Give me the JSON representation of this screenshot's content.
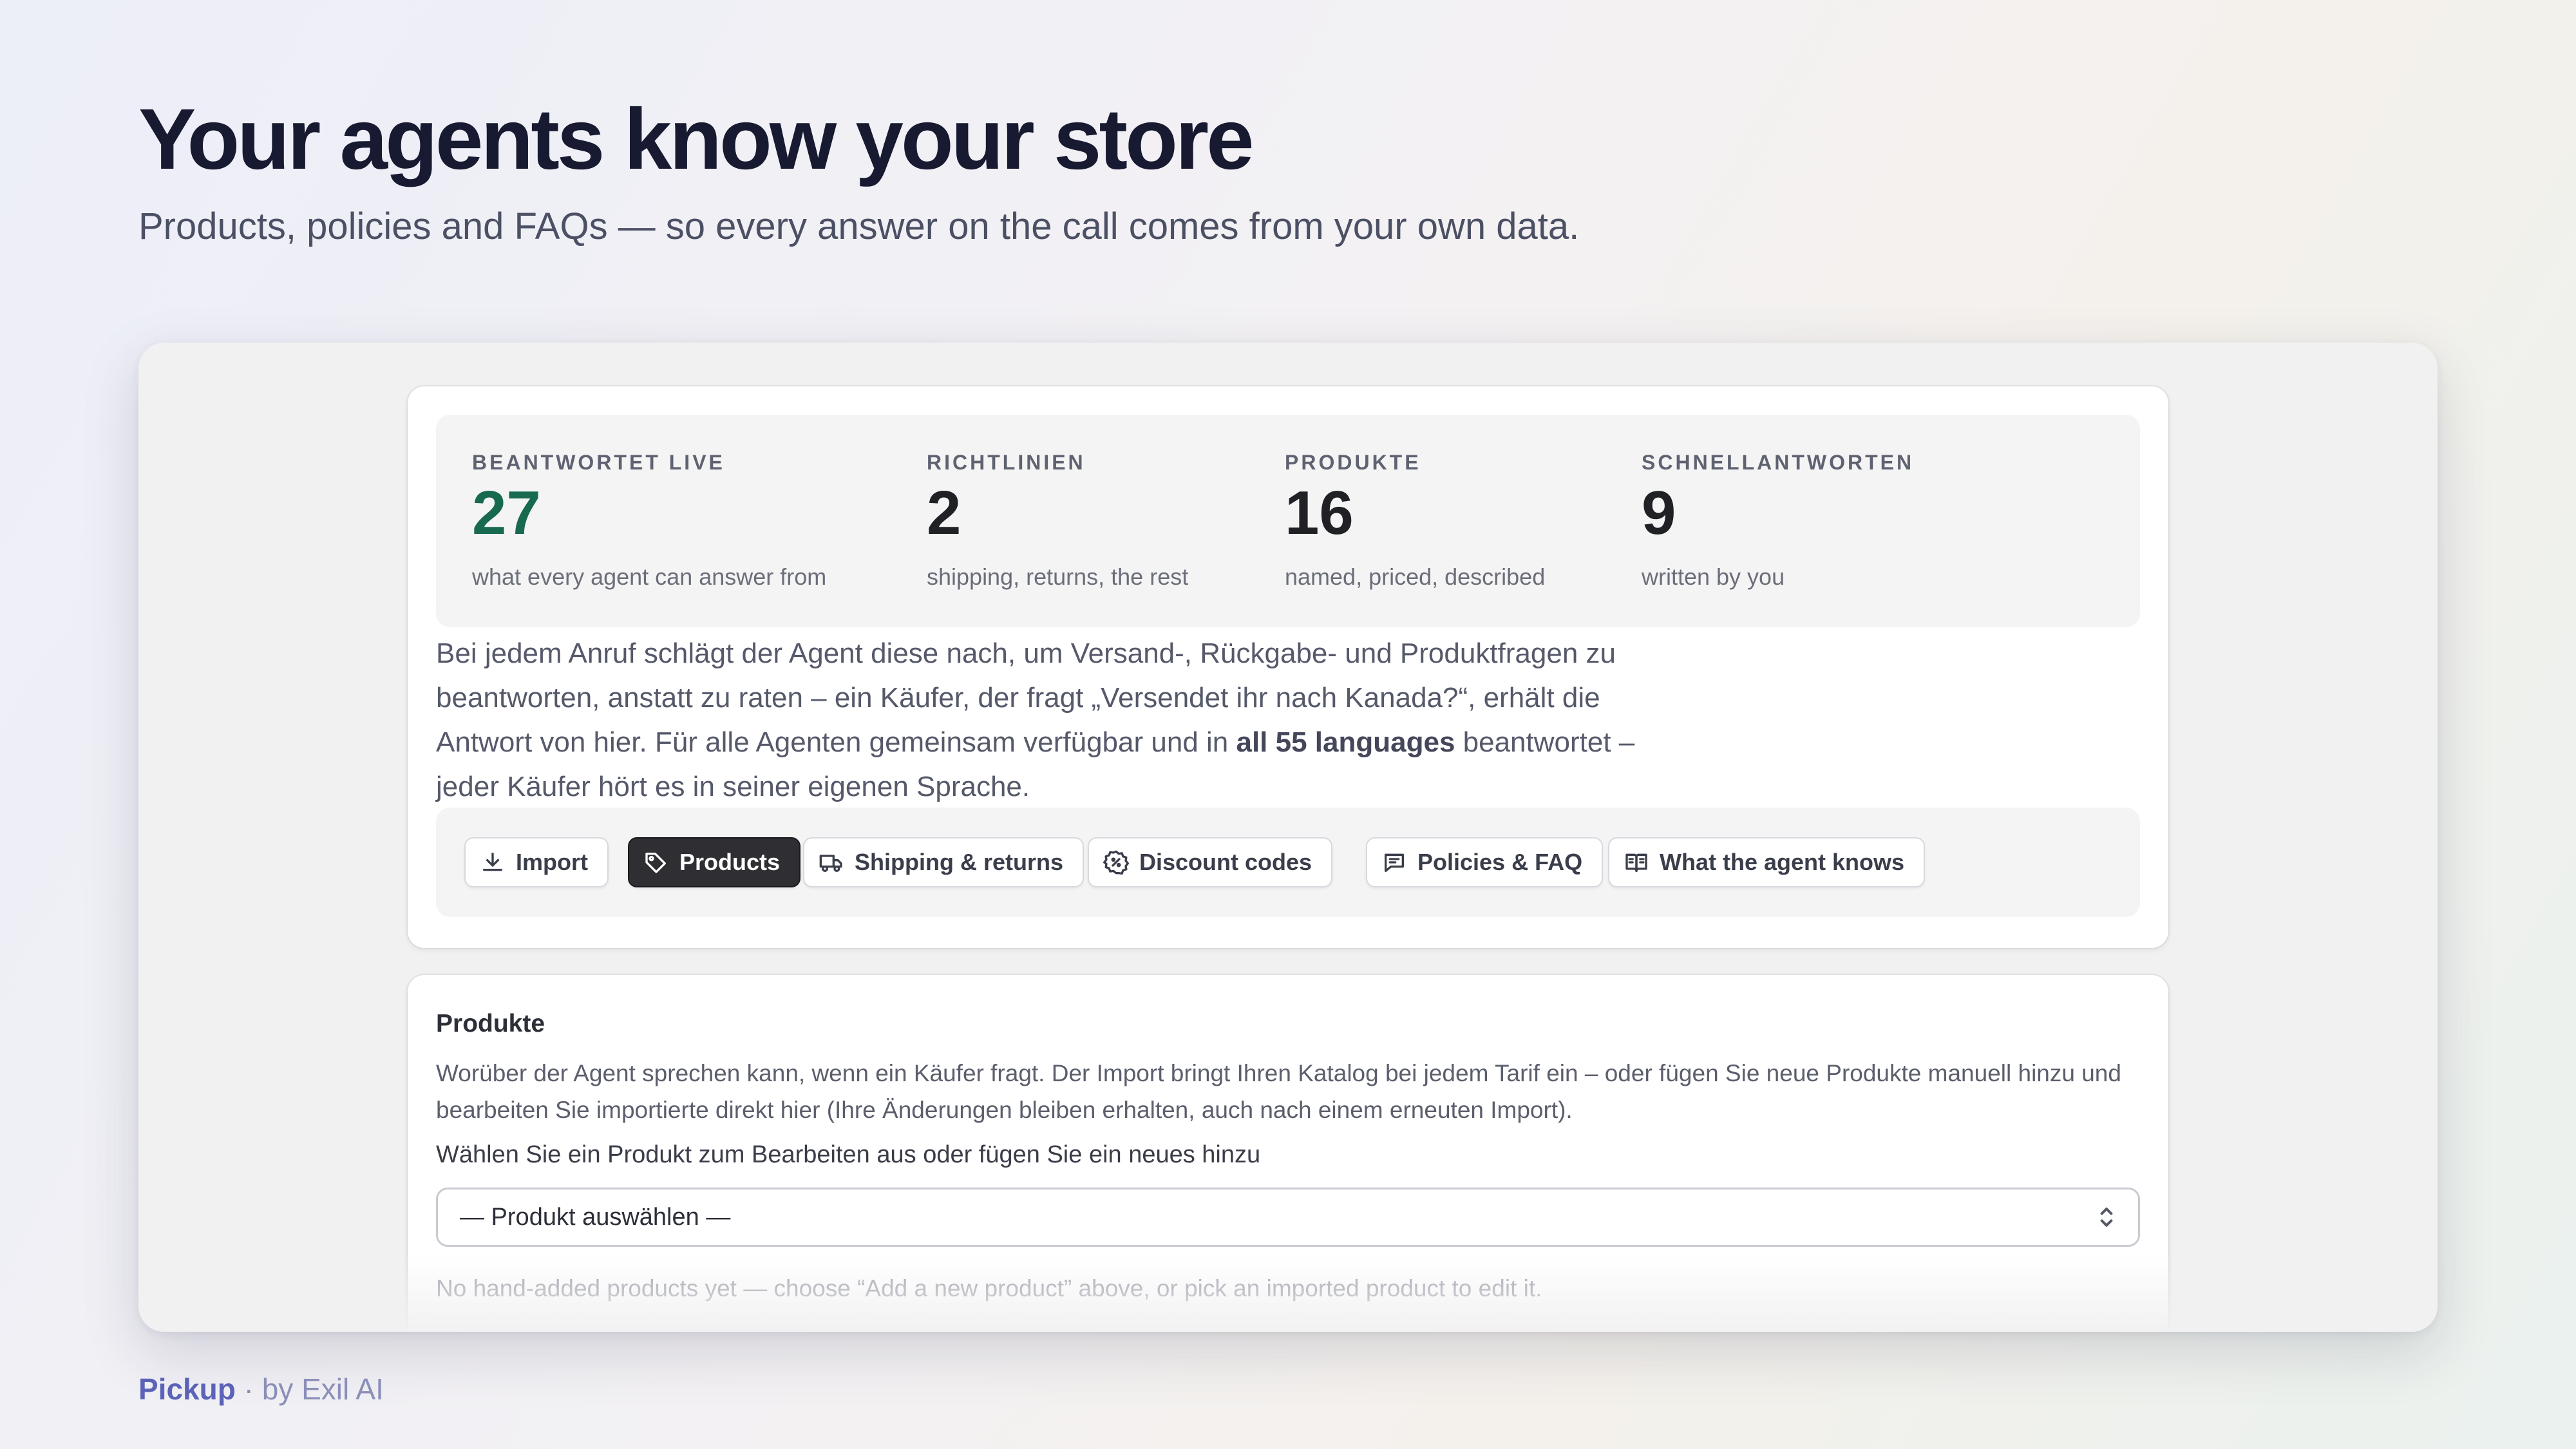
{
  "hero": {
    "title": "Your agents know your store",
    "subtitle": "Products, policies and FAQs — so every answer on the call comes from your own data."
  },
  "stats": [
    {
      "label": "BEANTWORTET LIVE",
      "value": "27",
      "desc": "what every agent can answer from"
    },
    {
      "label": "RICHTLINIEN",
      "value": "2",
      "desc": "shipping, returns, the rest"
    },
    {
      "label": "PRODUKTE",
      "value": "16",
      "desc": "named, priced, described"
    },
    {
      "label": "SCHNELLANTWORTEN",
      "value": "9",
      "desc": "written by you"
    }
  ],
  "description": {
    "before": "Bei jedem Anruf schlägt der Agent diese nach, um Versand-, Rückgabe- und Produktfragen zu beantworten, anstatt zu raten – ein Käufer, der fragt „Versendet ihr nach Kanada?“, erhält die Antwort von hier. Für alle Agenten gemeinsam verfügbar und in ",
    "bold": "all 55 languages",
    "after": " beantwortet – jeder Käufer hört es in seiner eigenen Sprache."
  },
  "tabs": [
    {
      "label": "Import",
      "icon": "download-icon"
    },
    {
      "label": "Products",
      "icon": "tag-icon",
      "active": true
    },
    {
      "label": "Shipping & returns",
      "icon": "truck-icon"
    },
    {
      "label": "Discount codes",
      "icon": "discount-badge-icon"
    },
    {
      "label": "Policies & FAQ",
      "icon": "chat-bubble-icon"
    },
    {
      "label": "What the agent knows",
      "icon": "book-icon"
    }
  ],
  "products": {
    "title": "Produkte",
    "description": "Worüber der Agent sprechen kann, wenn ein Käufer fragt. Der Import bringt Ihren Katalog bei jedem Tarif ein – oder fügen Sie neue Produkte manuell hinzu und bearbeiten Sie importierte direkt hier (Ihre Änderungen bleiben erhalten, auch nach einem erneuten Import).",
    "select_label": "Wählen Sie ein Produkt zum Bearbeiten aus oder fügen Sie ein neues hinzu",
    "select_value": "— Produkt auswählen —",
    "empty_text": "No hand-added products yet — choose “Add a new product” above, or pick an imported product to edit it."
  },
  "footer": {
    "brand": "Pickup",
    "suffix": " · by Exil AI"
  },
  "colors": {
    "accent_green": "#17694f",
    "active_tab": "#2f2f33",
    "brand": "#5b62b8"
  }
}
